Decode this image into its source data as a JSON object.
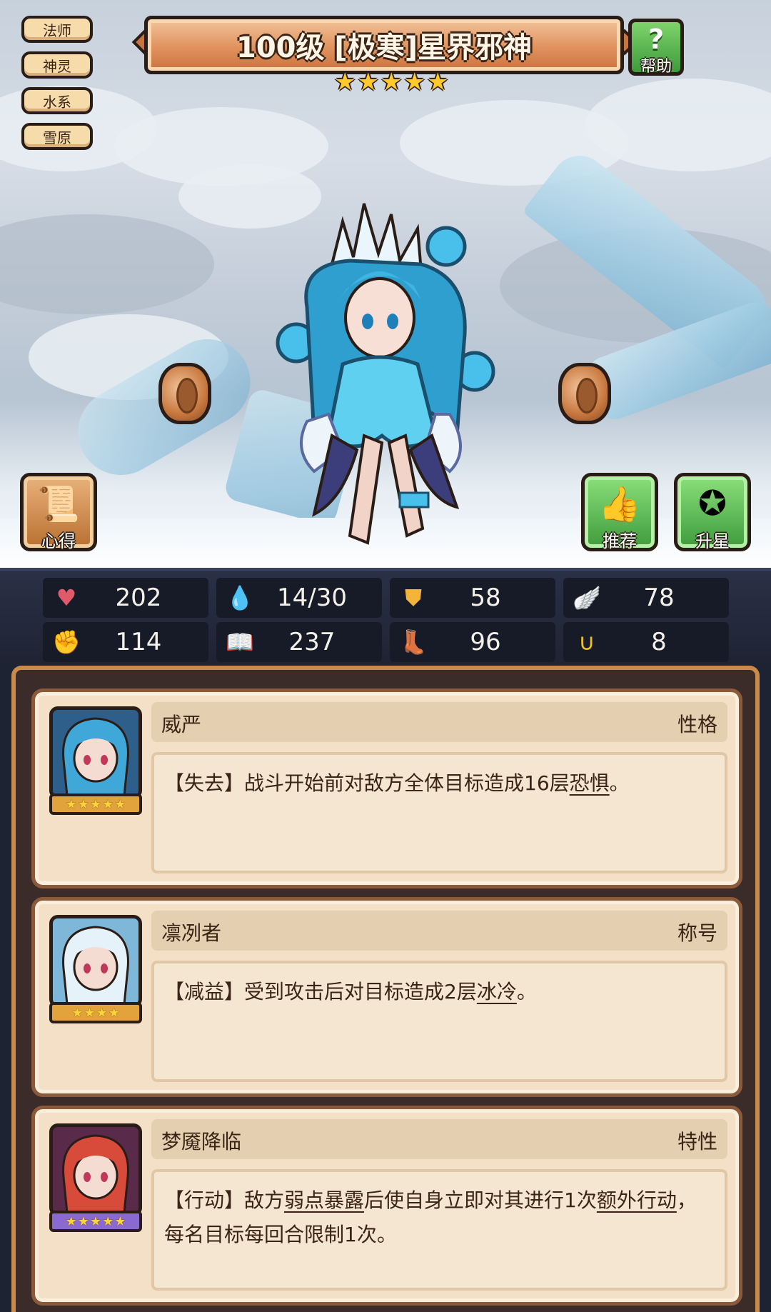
{
  "tags": [
    "法师",
    "神灵",
    "水系",
    "雪原"
  ],
  "title": "100级 [极寒]星界邪神",
  "star_count": 5,
  "help_label": "帮助",
  "buttons": {
    "insight": "心得",
    "recommend": "推荐",
    "star_up": "升星"
  },
  "stats": [
    {
      "icon": "heart-icon",
      "value": "202",
      "color": "#e05a6a"
    },
    {
      "icon": "water-drop-icon",
      "value": "14/30",
      "color": "#5cc2f0"
    },
    {
      "icon": "shield-icon",
      "value": "58",
      "color": "#f2b53a"
    },
    {
      "icon": "wing-icon",
      "value": "78",
      "color": "#e8eef5"
    },
    {
      "icon": "fist-icon",
      "value": "114",
      "color": "#e8a07a"
    },
    {
      "icon": "book-icon",
      "value": "237",
      "color": "#d84a4a"
    },
    {
      "icon": "boot-icon",
      "value": "96",
      "color": "#4f8fe0"
    },
    {
      "icon": "horseshoe-icon",
      "value": "8",
      "color": "#f2c21a"
    }
  ],
  "skills": [
    {
      "name": "威严",
      "type": "性格",
      "portrait_stars": 5,
      "frame_color": "#e2a23c",
      "portrait_bg": "#2d5f8a",
      "hair": "#3fa8d8",
      "desc_parts": [
        {
          "t": "【失去】战斗开始前对敌方全体目标造成16层"
        },
        {
          "t": "恐惧",
          "kw": true
        },
        {
          "t": "。"
        }
      ]
    },
    {
      "name": "凛冽者",
      "type": "称号",
      "portrait_stars": 4,
      "frame_color": "#e2a23c",
      "portrait_bg": "#7fb7d8",
      "hair": "#e6f2fa",
      "desc_parts": [
        {
          "t": "【减益】受到攻击后对目标造成2层"
        },
        {
          "t": "冰冷",
          "kw": true
        },
        {
          "t": "。"
        }
      ]
    },
    {
      "name": "梦魇降临",
      "type": "特性",
      "portrait_stars": 5,
      "frame_color": "#8a6ad0",
      "portrait_bg": "#5a2a4a",
      "hair": "#d84a3a",
      "desc_parts": [
        {
          "t": "【行动】敌方"
        },
        {
          "t": "弱点暴露",
          "kw": true
        },
        {
          "t": "后使自身立即对其进行1次"
        },
        {
          "t": "额外行动",
          "kw": true
        },
        {
          "t": "，每名目标每回合限制1次。"
        }
      ]
    }
  ]
}
